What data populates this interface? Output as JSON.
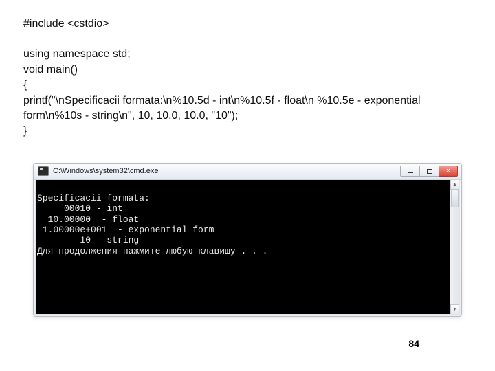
{
  "code": {
    "l1": "#include <cstdio>",
    "l2": "using namespace std;",
    "l3": "void main()",
    "l4": "{",
    "l5": "printf(\"\\nSpecificacii formata:\\n%10.5d - int\\n%10.5f  - float\\n %10.5e  - exponential form\\n%10s - string\\n\", 10, 10.0, 10.0, \"10\");",
    "l6": "}"
  },
  "console": {
    "title": "C:\\Windows\\system32\\cmd.exe",
    "lines": {
      "o0": "",
      "o1": "Specificacii formata:",
      "o2": "     00010 - int",
      "o3": "  10.00000  - float",
      "o4": " 1.00000e+001  - exponential form",
      "o5": "        10 - string",
      "o6": "Для продолжения нажмите любую клавишу . . ."
    }
  },
  "pageNumber": "84"
}
